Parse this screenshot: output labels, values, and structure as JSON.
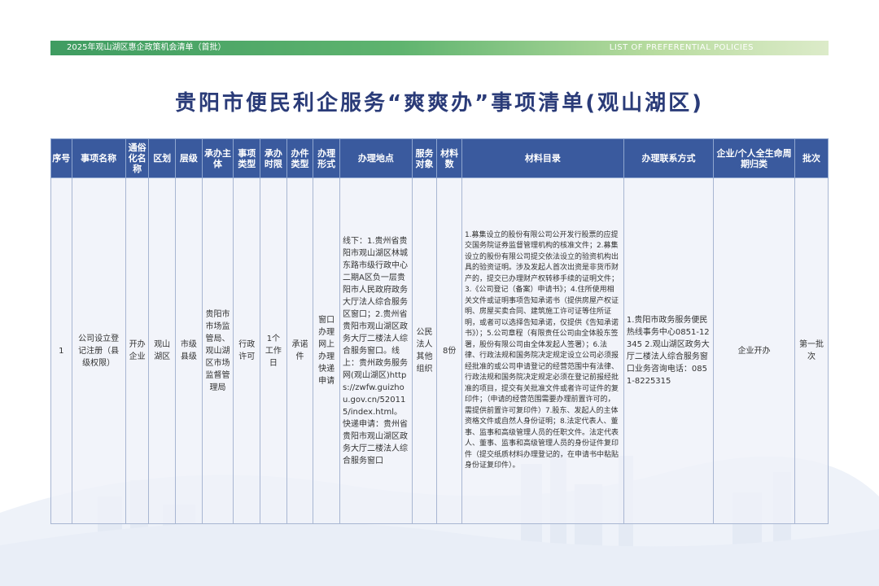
{
  "banner": {
    "title": "2025年观山湖区惠企政策机会清单（首批）",
    "english": "LIST OF PREFERENTIAL POLICIES"
  },
  "page_title": "贵阳市便民利企服务“爽爽办”事项清单(观山湖区)",
  "colors": {
    "header_bg": "#3a5a9e",
    "title": "#2a3b78",
    "banner_green": "#3f9c61"
  },
  "table": {
    "headers": [
      "序号",
      "事项名称",
      "通俗化名称",
      "区划",
      "层级",
      "承办主体",
      "事项类型",
      "承办时限",
      "办件类型",
      "办理形式",
      "办理地点",
      "服务对象",
      "材料数",
      "材料目录",
      "办理联系方式",
      "企业/个人全生命周期归类",
      "批次"
    ],
    "row": {
      "seq": "1",
      "name": "公司设立登记注册（县级权限）",
      "common_name": "开办企业",
      "district": "观山湖区",
      "level": "市级县级",
      "organizer": "贵阳市市场监管局、观山湖区市场监督管理局",
      "item_type": "行政许可",
      "time_limit": "1个工作日",
      "case_type": "承诺件",
      "form": "窗口办理网上办理快递申请",
      "location": "线下：1.贵州省贵阳市观山湖区林城东路市级行政中心二期A区负一层贵阳市人民政府政务大厅法人综合服务区窗口；2.贵州省贵阳市观山湖区政务大厅二楼法人综合服务窗口。线上：贵州政务服务网(观山湖区)https://zwfw.guizhou.gov.cn/520115/index.html。快递申请：贵州省贵阳市观山湖区政务大厅二楼法人综合服务窗口",
      "target": "公民法人其他组织",
      "material_count": "8份",
      "materials": "1.募集设立的股份有限公司公开发行股票的应提交国务院证券监督管理机构的核准文件；2.募集设立的股份有限公司提交依法设立的验资机构出具的验资证明。涉及发起人首次出资是非货币财产的，提交已办理财产权转移手续的证明文件；3.《公司登记（备案）申请书》；4.住所使用相关文件或证明事项告知承诺书（提供房屋产权证明、房屋买卖合同、建筑施工许可证等住所证明，或者可以选择告知承诺，仅提供《告知承诺书》）；5.公司章程（有限责任公司由全体股东签署，股份有限公司由全体发起人签署）；6.法律、行政法规和国务院决定规定设立公司必须报经批准的或公司申请登记的经营范围中有法律、行政法规和国务院决定规定必须在登记前报经批准的项目，提交有关批准文件或者许可证件的复印件；（申请的经营范围需要办理前置许可的，需提供前置许可复印件）7.股东、发起人的主体资格文件或自然人身份证明；8.法定代表人、董事、监事和高级管理人员的任职文件。法定代表人、董事、监事和高级管理人员的身份证件复印件（提交纸质材料办理登记的，在申请书中粘贴身份证复印件）。",
      "contact": "1.贵阳市政务服务便民热线事务中心0851-12345 2.观山湖区政务大厅二楼法人综合服务窗口业务咨询电话：0851-8225315",
      "lifecycle": "企业开办",
      "batch": "第一批次"
    }
  }
}
